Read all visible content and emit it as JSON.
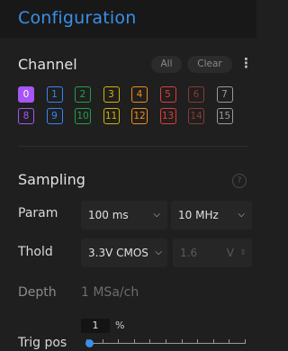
{
  "header": {
    "title": "Configuration"
  },
  "channel": {
    "title": "Channel",
    "all_label": "All",
    "clear_label": "Clear",
    "menu_icon": "kebab-menu-icon",
    "items": [
      {
        "label": "0",
        "color": "#a855f7",
        "selected": true
      },
      {
        "label": "1",
        "color": "#3b82f6"
      },
      {
        "label": "2",
        "color": "#22a04a"
      },
      {
        "label": "3",
        "color": "#d4b106"
      },
      {
        "label": "4",
        "color": "#f08c1a"
      },
      {
        "label": "5",
        "color": "#e23b3b"
      },
      {
        "label": "6",
        "color": "#8a3b32"
      },
      {
        "label": "7",
        "color": "#9a9a9a"
      },
      {
        "label": "8",
        "color": "#a855f7"
      },
      {
        "label": "9",
        "color": "#3b82f6"
      },
      {
        "label": "10",
        "color": "#22a04a"
      },
      {
        "label": "11",
        "color": "#d4b106"
      },
      {
        "label": "12",
        "color": "#f08c1a"
      },
      {
        "label": "13",
        "color": "#e23b3b"
      },
      {
        "label": "14",
        "color": "#8a3b32"
      },
      {
        "label": "15",
        "color": "#9a9a9a"
      }
    ]
  },
  "sampling": {
    "title": "Sampling",
    "help_icon": "help-icon",
    "param_label": "Param",
    "param_time": "100 ms",
    "param_rate": "10 MHz",
    "thold_label": "Thold",
    "thold_value": "3.3V CMOS",
    "thold_voltage": "1.6",
    "thold_unit": "V",
    "depth_label": "Depth",
    "depth_value": "1 MSa/ch",
    "trig_label": "Trig pos",
    "trig_value": "1",
    "trig_unit": "%",
    "trig_fraction": 0.01
  },
  "colors": {
    "accent": "#3b8fe8",
    "background": "#1f1f1f"
  }
}
